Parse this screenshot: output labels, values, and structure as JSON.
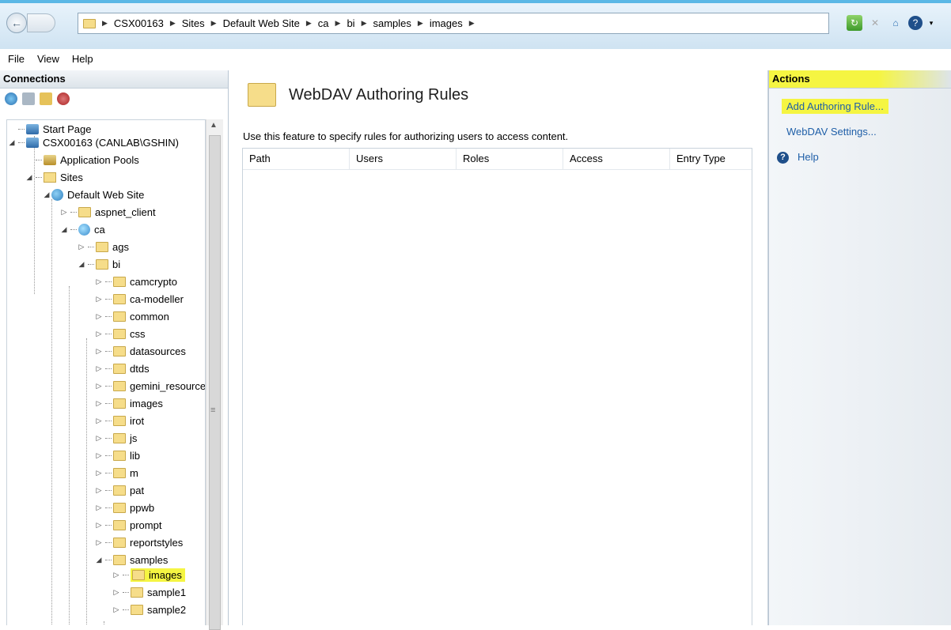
{
  "address": {
    "crumbs": [
      "CSX00163",
      "Sites",
      "Default Web Site",
      "ca",
      "bi",
      "samples",
      "images"
    ]
  },
  "menu": [
    "File",
    "View",
    "Help"
  ],
  "connections": {
    "title": "Connections",
    "tree": {
      "start_page": "Start Page",
      "server": "CSX00163 (CANLAB\\GSHIN)",
      "app_pools": "Application Pools",
      "sites": "Sites",
      "default_site": "Default Web Site",
      "aspnet_client": "aspnet_client",
      "ca": "ca",
      "ags": "ags",
      "bi": "bi",
      "bi_children": [
        "camcrypto",
        "ca-modeller",
        "common",
        "css",
        "datasources",
        "dtds",
        "gemini_resources",
        "images",
        "irot",
        "js",
        "lib",
        "m",
        "pat",
        "ppwb",
        "prompt",
        "reportstyles",
        "samples"
      ],
      "samples_children": [
        "images",
        "sample1",
        "sample2"
      ]
    }
  },
  "center": {
    "title": "WebDAV Authoring Rules",
    "description": "Use this feature to specify rules for authorizing users to access content.",
    "columns": [
      "Path",
      "Users",
      "Roles",
      "Access",
      "Entry Type"
    ]
  },
  "actions": {
    "title": "Actions",
    "add_rule": "Add Authoring Rule...",
    "settings": "WebDAV Settings...",
    "help": "Help"
  },
  "colors": {
    "highlight": "#f5f542",
    "link": "#1f5fa8",
    "accent": "#5bb8e6"
  }
}
